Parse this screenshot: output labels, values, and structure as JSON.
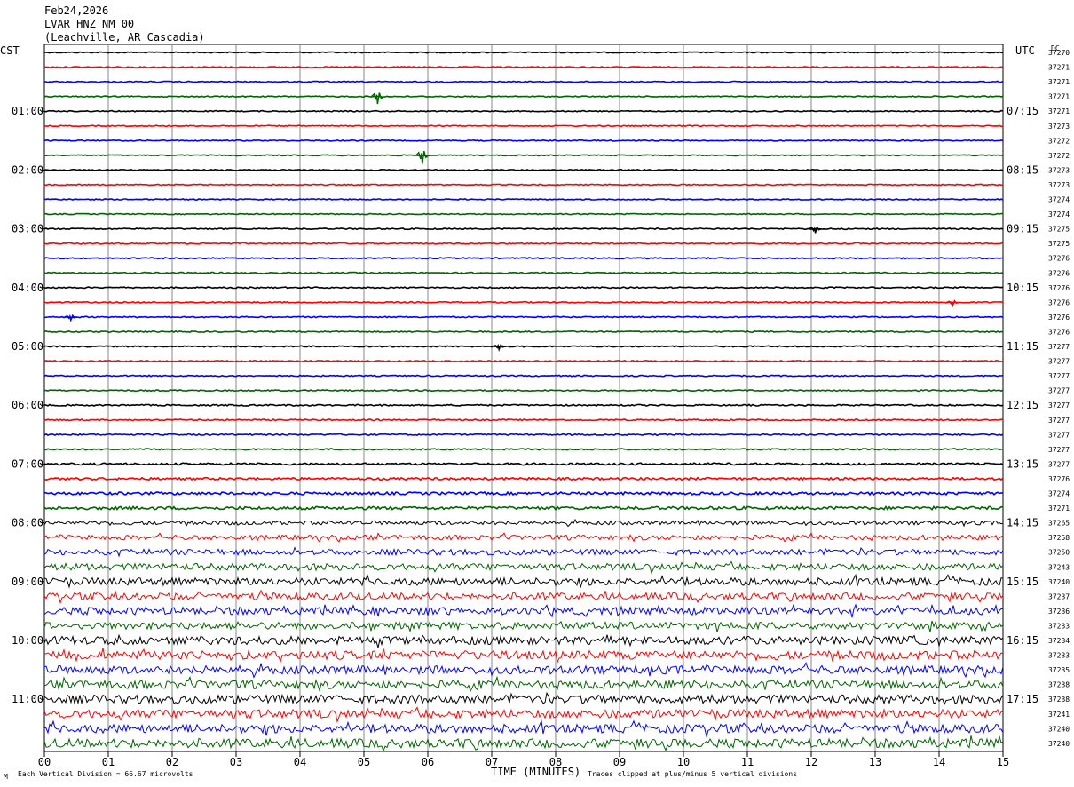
{
  "header": {
    "date": "Feb24,2026",
    "station": "LVAR HNZ NM 00",
    "location": "(Leachville, AR Cascadia)"
  },
  "left_axis_label": "CST",
  "right_axis_label": "UTC",
  "dc_label": "DC",
  "footer": {
    "logo": "M",
    "scale_note": "Each Vertical Division =   66.67 microvolts",
    "xlabel": "TIME (MINUTES)",
    "clip_note": "Traces clipped at plus/minus 5 vertical divisions"
  },
  "chart_data": {
    "type": "line",
    "title": "LVAR HNZ NM 00",
    "xlabel": "TIME (MINUTES)",
    "xlim": [
      0,
      15
    ],
    "x_ticks": [
      "00",
      "01",
      "02",
      "03",
      "04",
      "05",
      "06",
      "07",
      "08",
      "09",
      "10",
      "11",
      "12",
      "13",
      "14",
      "15"
    ],
    "grid": true,
    "colors": [
      "#000000",
      "#ff0000",
      "#0000ff",
      "#006400"
    ],
    "left_hour_labels": [
      "01:00",
      "02:00",
      "03:00",
      "04:00",
      "05:00",
      "06:00",
      "07:00",
      "08:00",
      "09:00",
      "10:00",
      "11:00"
    ],
    "right_hour_labels": [
      "07:15",
      "08:15",
      "09:15",
      "10:15",
      "11:15",
      "12:15",
      "13:15",
      "14:15",
      "15:15",
      "16:15",
      "17:15"
    ],
    "dc_offsets": [
      37270,
      37271,
      37271,
      37271,
      37271,
      37273,
      37272,
      37272,
      37273,
      37273,
      37274,
      37274,
      37275,
      37275,
      37276,
      37276,
      37276,
      37276,
      37276,
      37276,
      37277,
      37277,
      37277,
      37277,
      37277,
      37277,
      37277,
      37277,
      37277,
      37276,
      37274,
      37271,
      37265,
      37258,
      37250,
      37243,
      37240,
      37237,
      37236,
      37233,
      37234,
      37233,
      37235,
      37238,
      37238,
      37241,
      37240,
      37240
    ],
    "noise_levels": [
      0.6,
      0.6,
      0.6,
      0.6,
      0.6,
      0.6,
      0.6,
      0.6,
      0.6,
      0.6,
      0.6,
      0.6,
      0.7,
      0.7,
      0.7,
      0.7,
      0.7,
      0.7,
      0.7,
      0.7,
      0.7,
      0.7,
      0.7,
      0.7,
      0.8,
      0.8,
      0.8,
      0.8,
      1.2,
      1.3,
      1.5,
      1.7,
      2.2,
      2.8,
      3.2,
      3.8,
      4.2,
      4.0,
      4.2,
      4.0,
      4.6,
      4.8,
      4.6,
      4.6,
      4.8,
      4.8,
      4.8,
      5.0
    ],
    "events": [
      {
        "trace": 3,
        "minute": 5.2,
        "amplitude": 7,
        "color_note": "green"
      },
      {
        "trace": 7,
        "minute": 5.9,
        "amplitude": 8,
        "color_note": "green"
      },
      {
        "trace": 12,
        "minute": 12.05,
        "amplitude": 4,
        "color_note": "black"
      },
      {
        "trace": 17,
        "minute": 14.2,
        "amplitude": 3,
        "color_note": "red"
      },
      {
        "trace": 18,
        "minute": 0.4,
        "amplitude": 3,
        "color_note": "blue"
      },
      {
        "trace": 20,
        "minute": 7.1,
        "amplitude": 3,
        "color_note": "black"
      }
    ]
  }
}
